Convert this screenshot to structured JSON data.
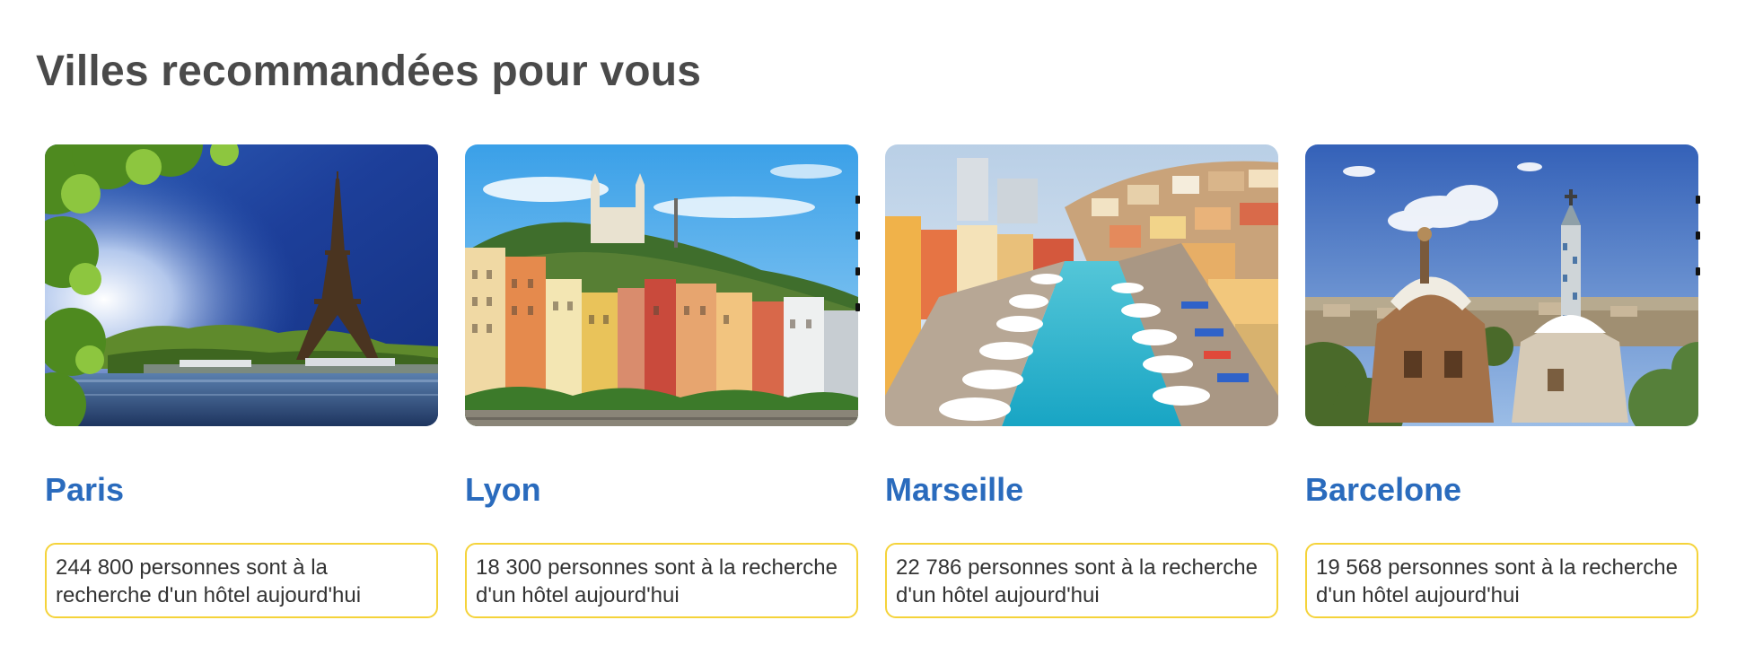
{
  "section": {
    "title": "Villes recommandées pour vous"
  },
  "cities": [
    {
      "name": "Paris",
      "info": "244 800 personnes sont à la recherche d'un hôtel aujourd'hui",
      "image_icon": "eiffel-tower-photo"
    },
    {
      "name": "Lyon",
      "info": "18 300 personnes sont à la recherche d'un hôtel aujourd'hui",
      "image_icon": "lyon-riverside-photo"
    },
    {
      "name": "Marseille",
      "info": "22 786 personnes sont à la recherche d'un hôtel aujourd'hui",
      "image_icon": "marseille-harbor-photo"
    },
    {
      "name": "Barcelone",
      "info": "19 568 personnes sont à la recherche d'un hôtel aujourd'hui",
      "image_icon": "barcelona-park-guell-photo"
    }
  ],
  "colors": {
    "title": "#4a4a4a",
    "city_name": "#2a6bbd",
    "info_border": "#f5d33a",
    "info_text": "#333333"
  }
}
